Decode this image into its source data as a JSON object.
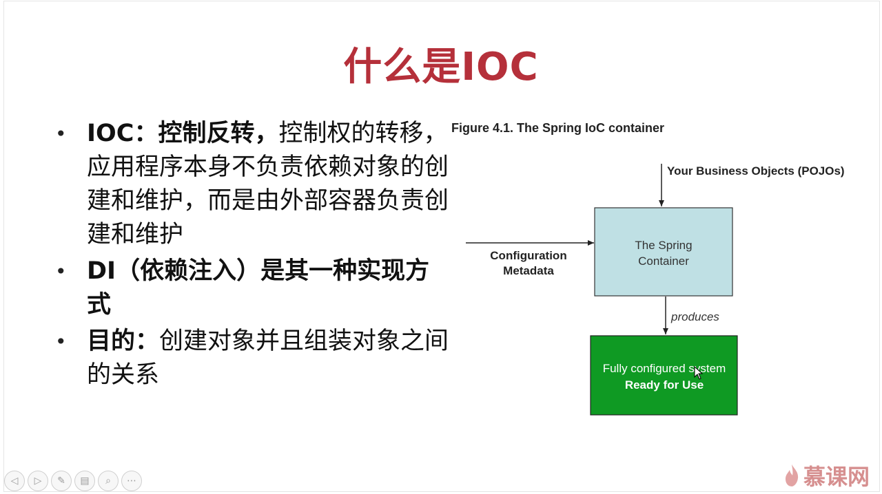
{
  "slide": {
    "title": "什么是IOC",
    "bullets": [
      {
        "dot": "•",
        "bold": "IOC：控制反转，",
        "text": "控制权的转移，应用程序本身不负责依赖对象的创建和维护，而是由外部容器负责创建和维护"
      },
      {
        "dot": "•",
        "bold": "DI（依赖注入）是其一种实现方式",
        "text": ""
      },
      {
        "dot": "•",
        "bold": "目的：",
        "text": "创建对象并且组装对象之间的关系"
      }
    ]
  },
  "figure": {
    "caption": "Figure 4.1. The Spring IoC container",
    "pojos_label": "Your Business Objects (POJOs)",
    "config_label_line1": "Configuration",
    "config_label_line2": "Metadata",
    "container_line1": "The Spring",
    "container_line2": "Container",
    "produces_label": "produces",
    "system_line1": "Fully configured system",
    "system_line2": "Ready for Use",
    "colors": {
      "container_fill": "#bfe0e4",
      "system_fill": "#0f9a23",
      "title": "#b5303a"
    }
  },
  "nav": {
    "buttons": [
      {
        "name": "previous-slide-button",
        "glyph": "◁"
      },
      {
        "name": "next-slide-button",
        "glyph": "▷"
      },
      {
        "name": "pen-tool-button",
        "glyph": "✎"
      },
      {
        "name": "slides-menu-button",
        "glyph": "▤"
      },
      {
        "name": "zoom-button",
        "glyph": "⌕"
      },
      {
        "name": "more-options-button",
        "glyph": "⋯"
      }
    ]
  },
  "watermark": {
    "text": "慕课网"
  }
}
